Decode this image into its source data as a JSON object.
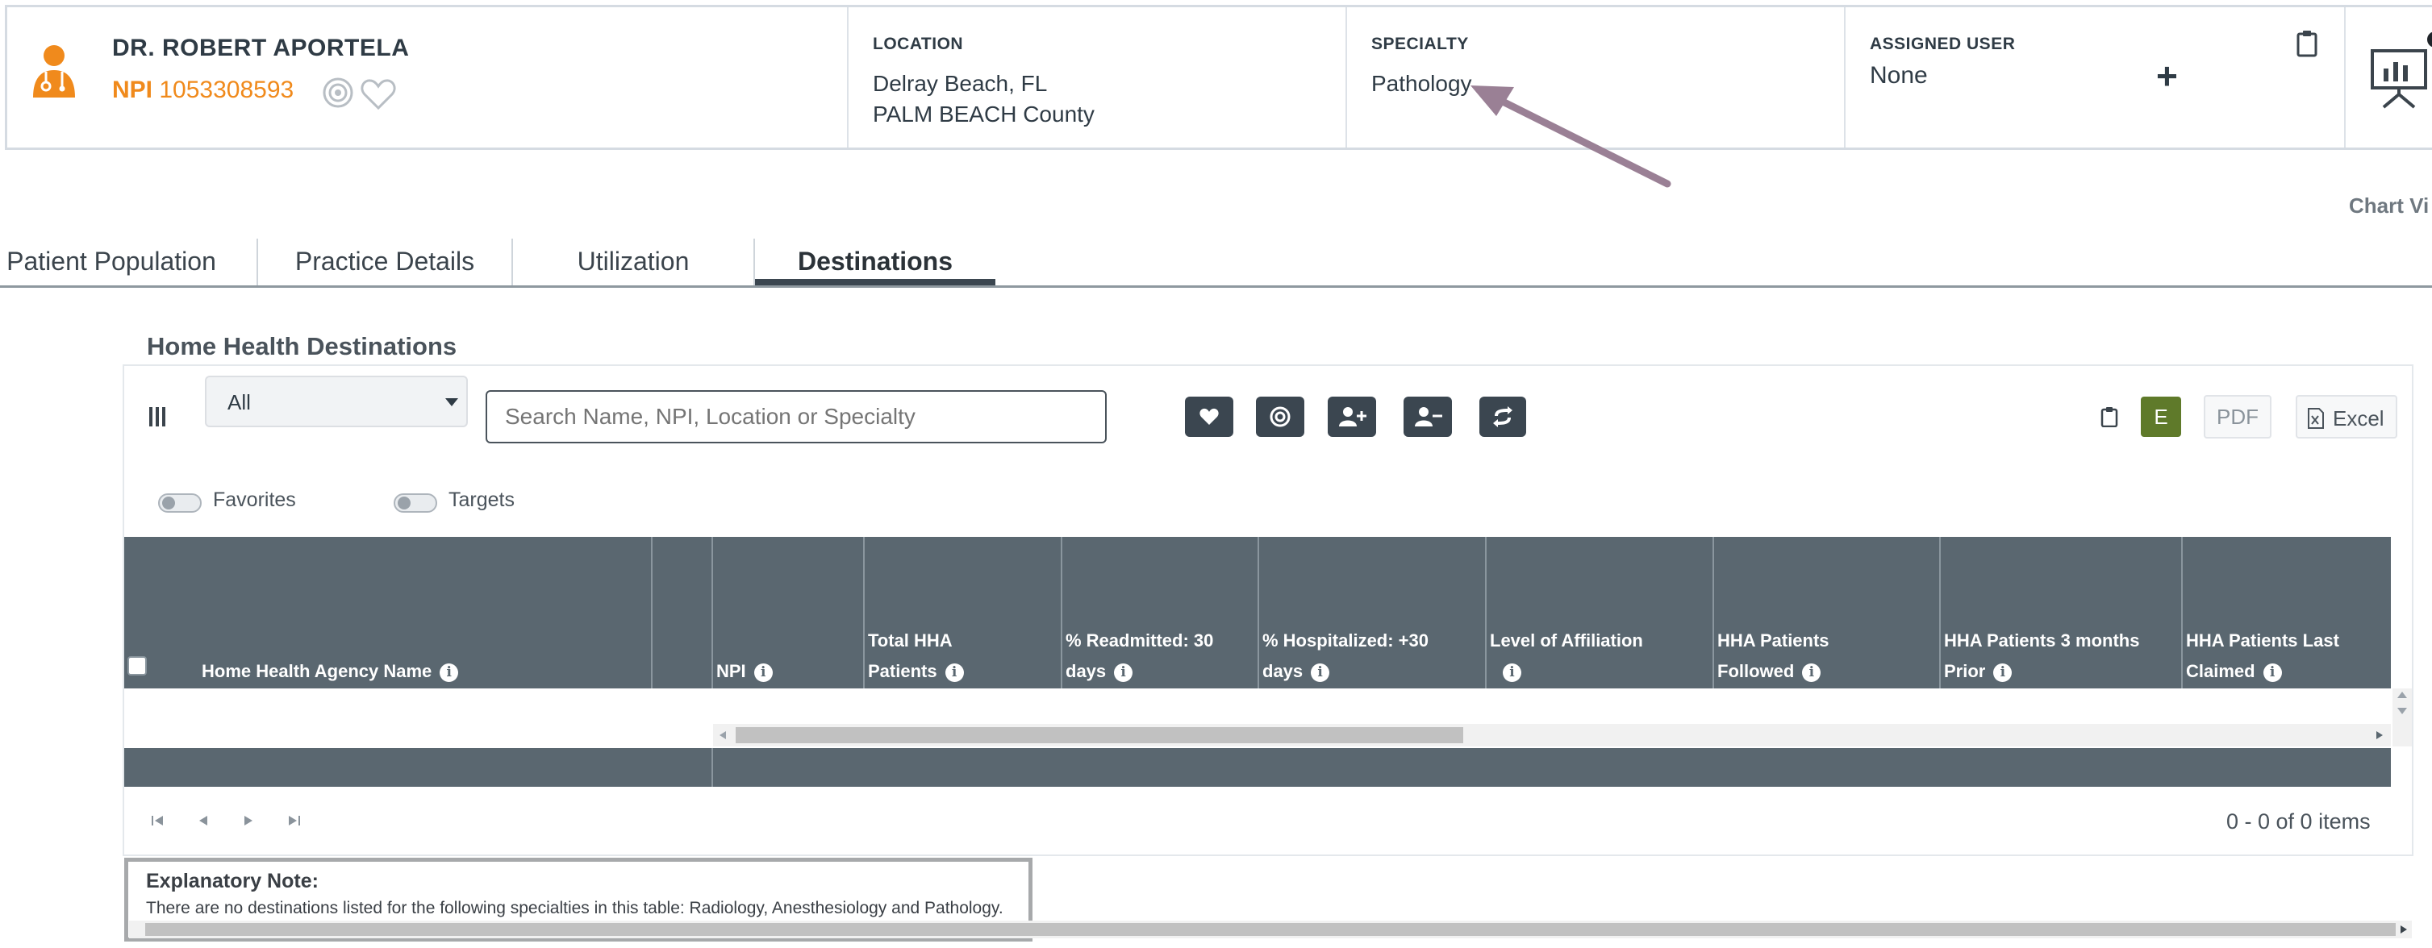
{
  "provider": {
    "name": "DR. ROBERT APORTELA",
    "npi_label": "NPI",
    "npi_value": "1053308593"
  },
  "header": {
    "location_label": "LOCATION",
    "location_line1": "Delray Beach, FL",
    "location_line2": "PALM BEACH County",
    "specialty_label": "SPECIALTY",
    "specialty_value": "Pathology",
    "assigned_label": "ASSIGNED USER",
    "assigned_value": "None",
    "add_symbol": "+",
    "chart_view_label": "Chart Vi"
  },
  "tabs": [
    {
      "label": "Patient Population",
      "active": false
    },
    {
      "label": "Practice Details",
      "active": false
    },
    {
      "label": "Utilization",
      "active": false
    },
    {
      "label": "Destinations",
      "active": true
    }
  ],
  "section": {
    "title": "Home Health Destinations"
  },
  "toolbar": {
    "filter_value": "All",
    "search_placeholder": "Search Name, NPI, Location or Specialty",
    "e_label": "E",
    "pdf_label": "PDF",
    "excel_label": "Excel",
    "icons": [
      "heart-icon",
      "target-icon",
      "add-user-icon",
      "remove-user-icon",
      "swap-icon"
    ]
  },
  "toggles": {
    "favorites_label": "Favorites",
    "targets_label": "Targets"
  },
  "table": {
    "columns": [
      {
        "line1": "",
        "line2": "Home Health Agency Name"
      },
      {
        "line1": "",
        "line2": "NPI"
      },
      {
        "line1": "Total HHA",
        "line2": "Patients"
      },
      {
        "line1": "% Readmitted: 30",
        "line2": "days"
      },
      {
        "line1": "% Hospitalized: +30",
        "line2": "days"
      },
      {
        "line1": "Level of Affiliation",
        "line2": ""
      },
      {
        "line1": "HHA Patients",
        "line2": "Followed"
      },
      {
        "line1": "HHA Patients 3 months",
        "line2": "Prior"
      },
      {
        "line1": "HHA Patients Last",
        "line2": "Claimed"
      }
    ]
  },
  "pager": {
    "summary": "0 - 0 of 0 items"
  },
  "note": {
    "title": "Explanatory Note:",
    "text": "There are no destinations listed for the following specialties in this table: Radiology, Anesthesiology and Pathology."
  },
  "colors": {
    "accent_orange": "#f08a1c",
    "header_gray": "#5a6770",
    "button_dark": "#3b4650",
    "green_e": "#5f7a2a",
    "arrow": "#9a8095"
  }
}
